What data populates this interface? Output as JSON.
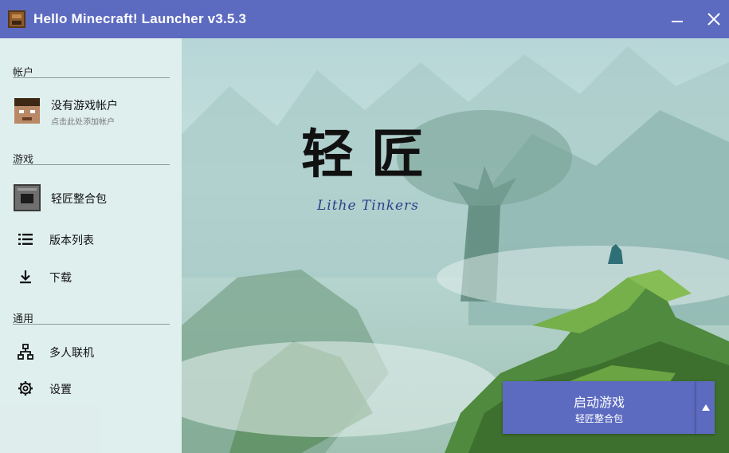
{
  "window": {
    "title": "Hello Minecraft! Launcher v3.5.3",
    "accent_color": "#5c6bc0",
    "minimize_icon": "minimize-icon",
    "close_icon": "close-icon"
  },
  "sidebar": {
    "account_section": {
      "title": "帐户",
      "account": {
        "name": "没有游戏帐户",
        "hint": "点击此处添加帐户",
        "icon": "steve-avatar"
      }
    },
    "game_section": {
      "title": "游戏",
      "selected_modpack": {
        "label": "轻匠整合包",
        "icon": "furnace-icon"
      },
      "items": [
        {
          "label": "版本列表",
          "icon": "list-icon"
        },
        {
          "label": "下载",
          "icon": "download-icon"
        }
      ]
    },
    "general_section": {
      "title": "通用",
      "items": [
        {
          "label": "多人联机",
          "icon": "network-icon"
        },
        {
          "label": "设置",
          "icon": "gear-icon"
        }
      ]
    }
  },
  "background": {
    "logo_chinese": "轻匠",
    "logo_english": "Lithe Tinkers"
  },
  "launch": {
    "title": "启动游戏",
    "subtitle": "轻匠整合包",
    "menu_icon": "triangle-up-icon"
  }
}
